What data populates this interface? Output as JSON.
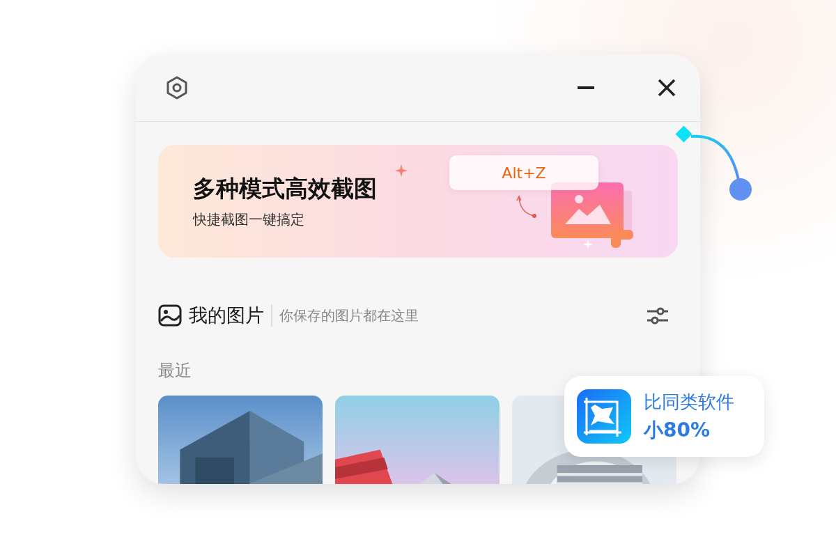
{
  "banner": {
    "title": "多种模式高效截图",
    "subtitle": "快捷截图一键搞定",
    "shortcut": "Alt+Z"
  },
  "section": {
    "title": "我的图片",
    "subtitle": "你保存的图片都在这里"
  },
  "recent": {
    "label": "最近"
  },
  "badge": {
    "line1": "比同类软件",
    "line2": "小80%"
  }
}
